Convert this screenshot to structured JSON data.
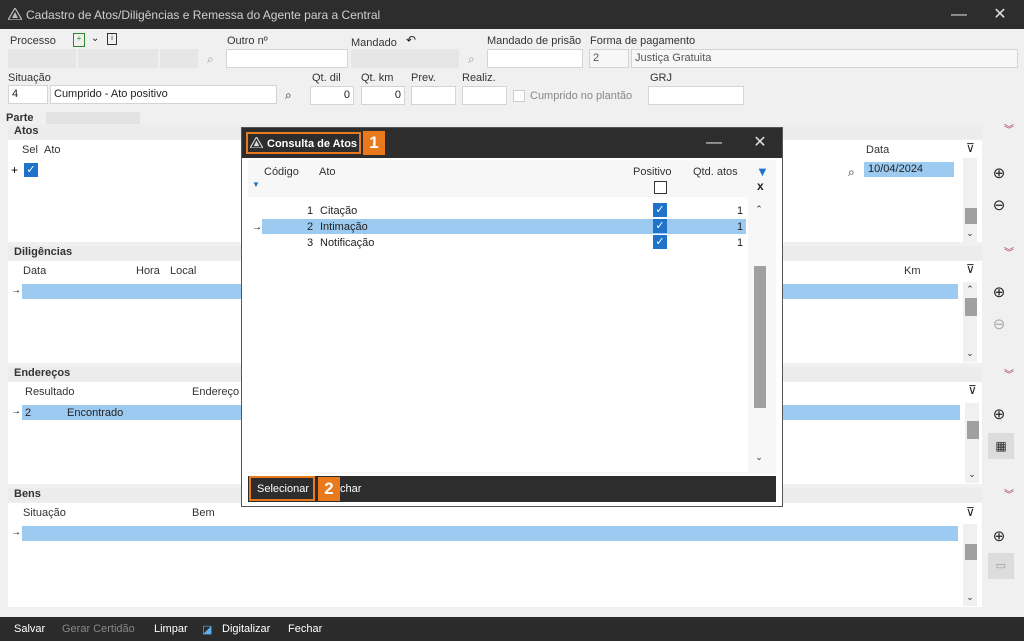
{
  "window": {
    "title": "Cadastro de Atos/Diligências e Remessa do Agente para a Central"
  },
  "form": {
    "processo_label": "Processo",
    "outro_label": "Outro nº",
    "mandado_label": "Mandado",
    "mandado_prisao_label": "Mandado de prisão",
    "forma_pagamento_label": "Forma de pagamento",
    "forma_pagamento_code": "2",
    "forma_pagamento_desc": "Justiça Gratuita",
    "situacao_label": "Situação",
    "situacao_code": "4",
    "situacao_desc": "Cumprido - Ato positivo",
    "qt_dil_label": "Qt. dil",
    "qt_dil": "0",
    "qt_km_label": "Qt. km",
    "qt_km": "0",
    "prev_label": "Prev.",
    "realiz_label": "Realiz.",
    "cumprido_plantao_label": "Cumprido no plantão",
    "grj_label": "GRJ",
    "parte_label": "Parte"
  },
  "atos": {
    "title": "Atos",
    "col_sel": "Sel",
    "col_ato": "Ato",
    "col_data": "Data",
    "row_plus": "+",
    "row_data": "10/04/2024"
  },
  "diligencias": {
    "title": "Diligências",
    "col_data": "Data",
    "col_hora": "Hora",
    "col_local": "Local",
    "col_km": "Km"
  },
  "enderecos": {
    "title": "Endereços",
    "col_resultado": "Resultado",
    "col_endereco": "Endereço",
    "row_code": "2",
    "row_resultado": "Encontrado"
  },
  "bens": {
    "title": "Bens",
    "col_situacao": "Situação",
    "col_bem": "Bem"
  },
  "footer": {
    "salvar": "Salvar",
    "gerar_certidao": "Gerar Certidão",
    "limpar": "Limpar",
    "digitalizar": "Digitalizar",
    "fechar": "Fechar"
  },
  "dialog": {
    "title": "Consulta de Atos",
    "badge1": "1",
    "badge2": "2",
    "col_codigo": "Código",
    "col_ato": "Ato",
    "col_positivo": "Positivo",
    "col_qtd": "Qtd. atos",
    "clear_filter": "x",
    "rows": [
      {
        "codigo": "1",
        "ato": "Citação",
        "qtd": "1"
      },
      {
        "codigo": "2",
        "ato": "Intimação",
        "qtd": "1"
      },
      {
        "codigo": "3",
        "ato": "Notificação",
        "qtd": "1"
      }
    ],
    "selecionar": "Selecionar",
    "fechar": "Fechar",
    "fechar_visible": "char"
  }
}
